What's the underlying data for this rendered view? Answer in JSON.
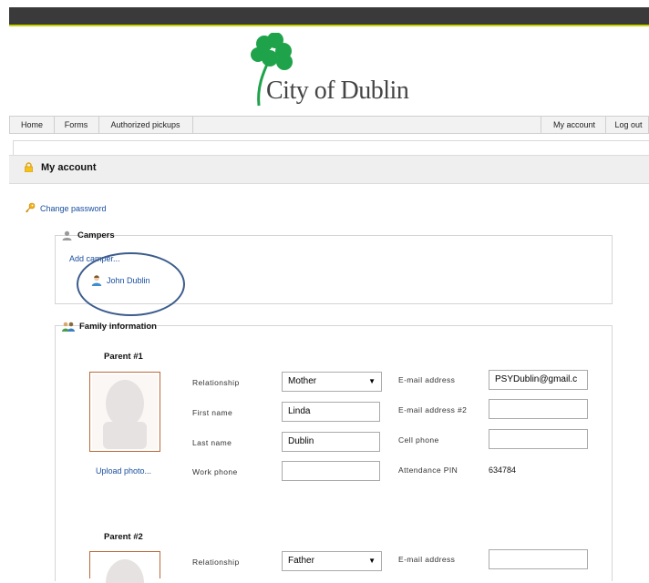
{
  "header": {
    "logo_text": "City of Dublin",
    "logo_icon": "shamrock-icon",
    "accent": "#c8d400",
    "brand_green": "#1ea34a"
  },
  "nav": {
    "left": [
      "Home",
      "Forms",
      "Authorized pickups"
    ],
    "right": [
      "My account",
      "Log out"
    ]
  },
  "page": {
    "title": "My account",
    "change_password": "Change password"
  },
  "campers": {
    "legend": "Campers",
    "add_link": "Add camper...",
    "items": [
      "John Dublin"
    ]
  },
  "family": {
    "legend": "Family information",
    "upload_photo": "Upload photo...",
    "parent1": {
      "title": "Parent #1",
      "relationship_label": "Relationship",
      "relationship": "Mother",
      "first_name_label": "First name",
      "first_name": "Linda",
      "last_name_label": "Last name",
      "last_name": "Dublin",
      "work_phone_label": "Work phone",
      "work_phone": "",
      "email_label": "E-mail address",
      "email": "PSYDublin@gmail.c",
      "email2_label": "E-mail address #2",
      "email2": "",
      "cell_label": "Cell phone",
      "cell": "",
      "pin_label": "Attendance PIN",
      "pin": "634784"
    },
    "parent2": {
      "title": "Parent #2",
      "relationship_label": "Relationship",
      "relationship": "Father",
      "email_label": "E-mail address",
      "email": ""
    }
  }
}
